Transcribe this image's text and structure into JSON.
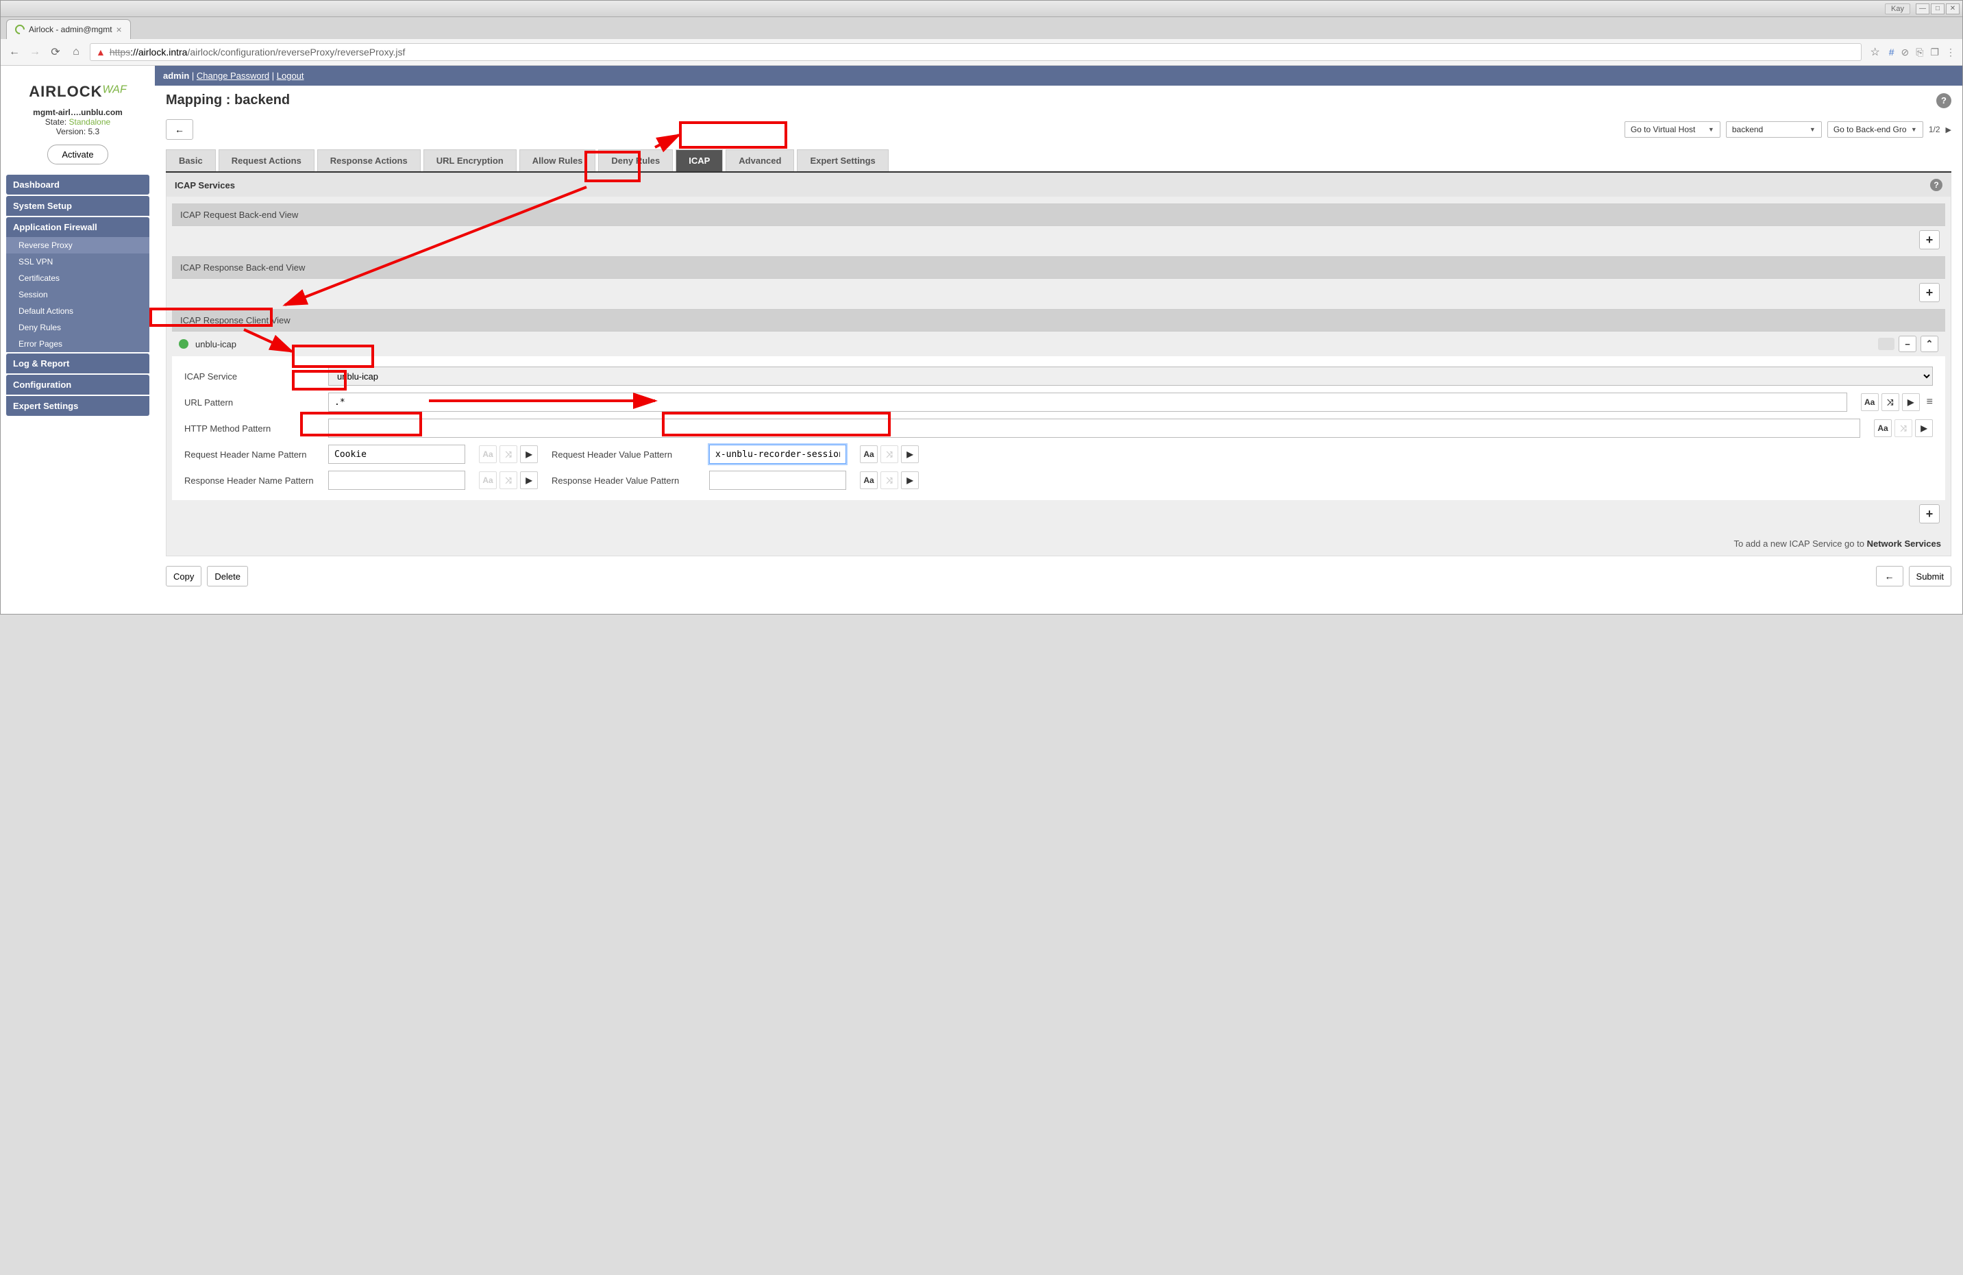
{
  "titlebar": {
    "user": "Kay"
  },
  "browser_tab": {
    "title": "Airlock - admin@mgmt"
  },
  "url": {
    "proto": "https",
    "host": "://airlock.intra",
    "path": "/airlock/configuration/reverseProxy/reverseProxy.jsf"
  },
  "userbar": {
    "user": "admin",
    "change_pw": "Change Password",
    "logout": "Logout"
  },
  "logo": {
    "main": "AIRLOCK",
    "suffix": "WAF"
  },
  "sidebar_info": {
    "host": "mgmt-airl….unblu.com",
    "state_label": "State:",
    "state": "Standalone",
    "version_label": "Version:",
    "version": "5.3"
  },
  "activate": "Activate",
  "nav": {
    "dashboard": "Dashboard",
    "system_setup": "System Setup",
    "app_firewall": "Application Firewall",
    "sub": {
      "reverse_proxy": "Reverse Proxy",
      "ssl_vpn": "SSL VPN",
      "certificates": "Certificates",
      "session": "Session",
      "default_actions": "Default Actions",
      "deny_rules": "Deny Rules",
      "error_pages": "Error Pages"
    },
    "log_report": "Log & Report",
    "configuration": "Configuration",
    "expert": "Expert Settings"
  },
  "page": {
    "title": "Mapping : backend"
  },
  "controls": {
    "goto_vh": "Go to Virtual Host",
    "backend_select": "backend",
    "goto_beg": "Go to Back-end Gro",
    "pager": "1/2"
  },
  "tabs": {
    "basic": "Basic",
    "req_actions": "Request Actions",
    "resp_actions": "Response Actions",
    "url_enc": "URL Encryption",
    "allow": "Allow Rules",
    "deny": "Deny Rules",
    "icap": "ICAP",
    "advanced": "Advanced",
    "expert": "Expert Settings"
  },
  "panel": {
    "title": "ICAP Services",
    "req_be": "ICAP Request Back-end View",
    "resp_be": "ICAP Response Back-end View",
    "resp_client": "ICAP Response Client View",
    "svc_name": "unblu-icap",
    "footer_a": "To add a new ICAP Service go to ",
    "footer_b": "Network Services"
  },
  "form": {
    "icap_service": "ICAP Service",
    "icap_service_val": "unblu-icap",
    "url_pattern": "URL Pattern",
    "url_pattern_val": ".*",
    "http_method": "HTTP Method Pattern",
    "http_method_val": "",
    "req_hdr_name": "Request Header Name Pattern",
    "req_hdr_name_val": "Cookie",
    "req_hdr_val": "Request Header Value Pattern",
    "req_hdr_val_val": "x-unblu-recorder-session=",
    "resp_hdr_name": "Response Header Name Pattern",
    "resp_hdr_name_val": "",
    "resp_hdr_val": "Response Header Value Pattern",
    "resp_hdr_val_val": ""
  },
  "buttons": {
    "copy": "Copy",
    "delete": "Delete",
    "submit": "Submit"
  }
}
